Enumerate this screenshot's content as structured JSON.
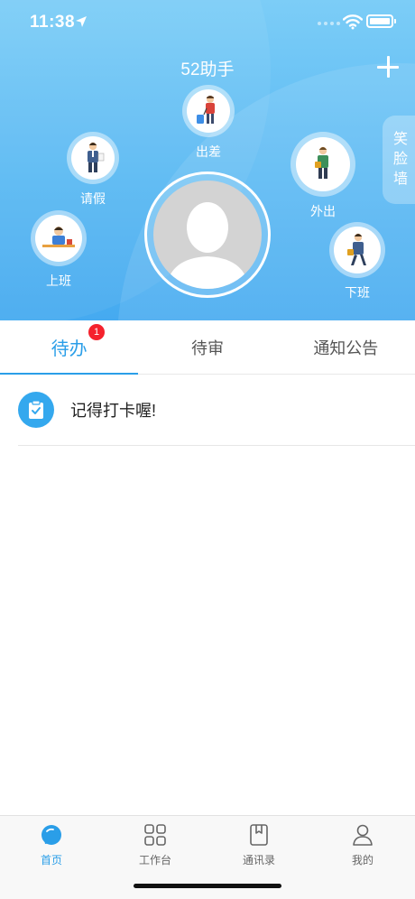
{
  "status_bar": {
    "time": "11:38"
  },
  "header": {
    "title": "52助手",
    "smile_wall": [
      "笑",
      "脸",
      "墙"
    ],
    "actions": {
      "business_trip": "出差",
      "leave": "请假",
      "out": "外出",
      "clock_in": "上班",
      "clock_out": "下班"
    }
  },
  "tabs": [
    {
      "label": "待办",
      "badge": "1"
    },
    {
      "label": "待审"
    },
    {
      "label": "通知公告"
    }
  ],
  "todo_items": [
    {
      "text": "记得打卡喔!"
    }
  ],
  "tab_bar": [
    {
      "label": "首页",
      "icon": "home-bubble-icon"
    },
    {
      "label": "工作台",
      "icon": "grid-icon"
    },
    {
      "label": "通讯录",
      "icon": "contacts-book-icon"
    },
    {
      "label": "我的",
      "icon": "person-icon"
    }
  ],
  "colors": {
    "accent": "#2a9ee8",
    "header_top": "#7ccdf7",
    "header_bottom": "#45aaf0",
    "badge": "#f5222d"
  }
}
